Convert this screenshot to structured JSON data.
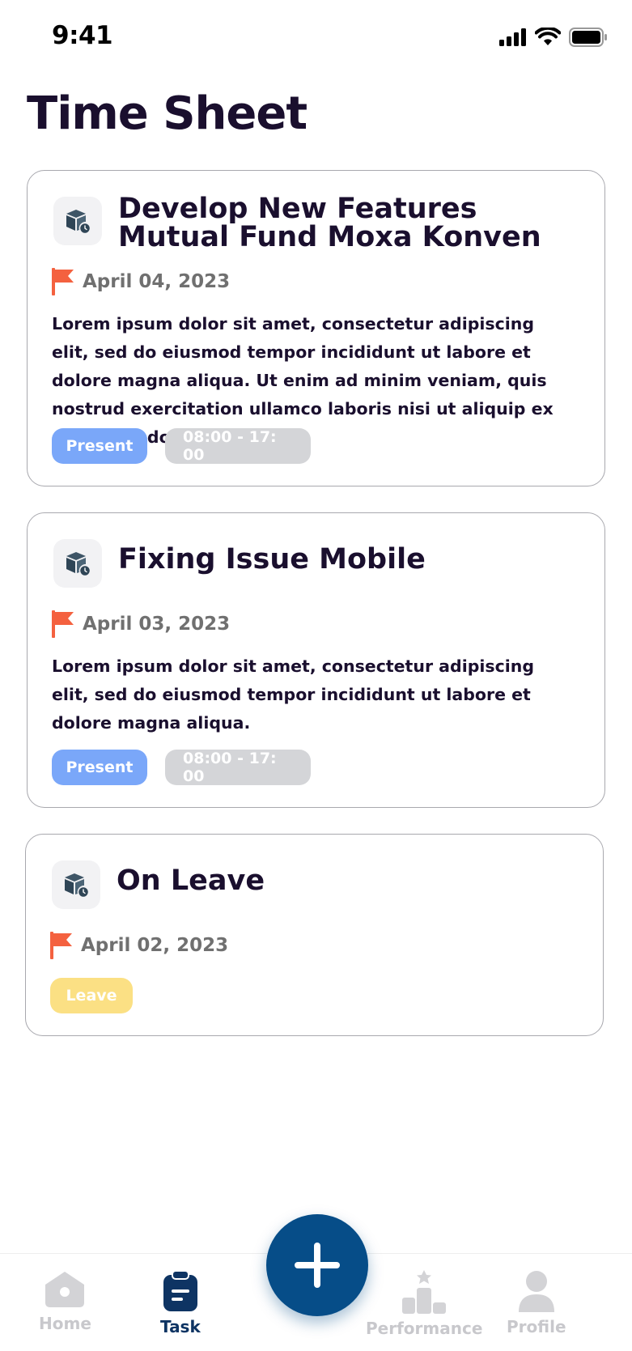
{
  "status": {
    "time": "9:41"
  },
  "page": {
    "title": "Time Sheet"
  },
  "cards": [
    {
      "title_line1": "Develop New Features",
      "title_line2": "Mutual Fund Moxa Konven",
      "date": "April 04, 2023",
      "description": "Lorem ipsum dolor sit amet, consectetur adipiscing elit, sed do eiusmod tempor incididunt ut labore et dolore magna aliqua. Ut enim ad minim veniam, quis nostrud exercitation ullamco laboris nisi ut aliquip ex ea commodo consequat.",
      "status": "Present",
      "hours": "08:00 - 17: 00"
    },
    {
      "title_line1": "Fixing Issue Mobile",
      "date": "April 03, 2023",
      "description": "Lorem ipsum dolor sit amet, consectetur adipiscing elit, sed do eiusmod tempor incididunt ut labore et dolore magna aliqua.",
      "status": "Present",
      "hours": "08:00 - 17: 00"
    },
    {
      "title_line1": "On Leave",
      "date": "April 02, 2023",
      "status": "Leave"
    }
  ],
  "nav": {
    "home": "Home",
    "task": "Task",
    "performance": "Performance",
    "profile": "Profile"
  },
  "colors": {
    "primary": "#064d88",
    "flag": "#f4613f",
    "present": "#7aa7f9",
    "leave": "#fbe084",
    "time_badge": "#d4d5d8"
  },
  "icons": [
    "signal-icon",
    "wifi-icon",
    "battery-icon",
    "box-clock-icon",
    "flag-icon",
    "home-icon",
    "clipboard-icon",
    "podium-icon",
    "user-icon",
    "plus-icon"
  ]
}
